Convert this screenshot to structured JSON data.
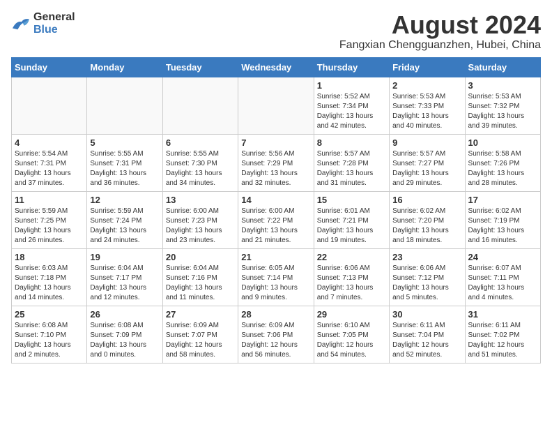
{
  "logo": {
    "line1": "General",
    "line2": "Blue"
  },
  "title": {
    "month_year": "August 2024",
    "location": "Fangxian Chengguanzhen, Hubei, China"
  },
  "weekdays": [
    "Sunday",
    "Monday",
    "Tuesday",
    "Wednesday",
    "Thursday",
    "Friday",
    "Saturday"
  ],
  "weeks": [
    [
      {
        "day": "",
        "info": ""
      },
      {
        "day": "",
        "info": ""
      },
      {
        "day": "",
        "info": ""
      },
      {
        "day": "",
        "info": ""
      },
      {
        "day": "1",
        "info": "Sunrise: 5:52 AM\nSunset: 7:34 PM\nDaylight: 13 hours\nand 42 minutes."
      },
      {
        "day": "2",
        "info": "Sunrise: 5:53 AM\nSunset: 7:33 PM\nDaylight: 13 hours\nand 40 minutes."
      },
      {
        "day": "3",
        "info": "Sunrise: 5:53 AM\nSunset: 7:32 PM\nDaylight: 13 hours\nand 39 minutes."
      }
    ],
    [
      {
        "day": "4",
        "info": "Sunrise: 5:54 AM\nSunset: 7:31 PM\nDaylight: 13 hours\nand 37 minutes."
      },
      {
        "day": "5",
        "info": "Sunrise: 5:55 AM\nSunset: 7:31 PM\nDaylight: 13 hours\nand 36 minutes."
      },
      {
        "day": "6",
        "info": "Sunrise: 5:55 AM\nSunset: 7:30 PM\nDaylight: 13 hours\nand 34 minutes."
      },
      {
        "day": "7",
        "info": "Sunrise: 5:56 AM\nSunset: 7:29 PM\nDaylight: 13 hours\nand 32 minutes."
      },
      {
        "day": "8",
        "info": "Sunrise: 5:57 AM\nSunset: 7:28 PM\nDaylight: 13 hours\nand 31 minutes."
      },
      {
        "day": "9",
        "info": "Sunrise: 5:57 AM\nSunset: 7:27 PM\nDaylight: 13 hours\nand 29 minutes."
      },
      {
        "day": "10",
        "info": "Sunrise: 5:58 AM\nSunset: 7:26 PM\nDaylight: 13 hours\nand 28 minutes."
      }
    ],
    [
      {
        "day": "11",
        "info": "Sunrise: 5:59 AM\nSunset: 7:25 PM\nDaylight: 13 hours\nand 26 minutes."
      },
      {
        "day": "12",
        "info": "Sunrise: 5:59 AM\nSunset: 7:24 PM\nDaylight: 13 hours\nand 24 minutes."
      },
      {
        "day": "13",
        "info": "Sunrise: 6:00 AM\nSunset: 7:23 PM\nDaylight: 13 hours\nand 23 minutes."
      },
      {
        "day": "14",
        "info": "Sunrise: 6:00 AM\nSunset: 7:22 PM\nDaylight: 13 hours\nand 21 minutes."
      },
      {
        "day": "15",
        "info": "Sunrise: 6:01 AM\nSunset: 7:21 PM\nDaylight: 13 hours\nand 19 minutes."
      },
      {
        "day": "16",
        "info": "Sunrise: 6:02 AM\nSunset: 7:20 PM\nDaylight: 13 hours\nand 18 minutes."
      },
      {
        "day": "17",
        "info": "Sunrise: 6:02 AM\nSunset: 7:19 PM\nDaylight: 13 hours\nand 16 minutes."
      }
    ],
    [
      {
        "day": "18",
        "info": "Sunrise: 6:03 AM\nSunset: 7:18 PM\nDaylight: 13 hours\nand 14 minutes."
      },
      {
        "day": "19",
        "info": "Sunrise: 6:04 AM\nSunset: 7:17 PM\nDaylight: 13 hours\nand 12 minutes."
      },
      {
        "day": "20",
        "info": "Sunrise: 6:04 AM\nSunset: 7:16 PM\nDaylight: 13 hours\nand 11 minutes."
      },
      {
        "day": "21",
        "info": "Sunrise: 6:05 AM\nSunset: 7:14 PM\nDaylight: 13 hours\nand 9 minutes."
      },
      {
        "day": "22",
        "info": "Sunrise: 6:06 AM\nSunset: 7:13 PM\nDaylight: 13 hours\nand 7 minutes."
      },
      {
        "day": "23",
        "info": "Sunrise: 6:06 AM\nSunset: 7:12 PM\nDaylight: 13 hours\nand 5 minutes."
      },
      {
        "day": "24",
        "info": "Sunrise: 6:07 AM\nSunset: 7:11 PM\nDaylight: 13 hours\nand 4 minutes."
      }
    ],
    [
      {
        "day": "25",
        "info": "Sunrise: 6:08 AM\nSunset: 7:10 PM\nDaylight: 13 hours\nand 2 minutes."
      },
      {
        "day": "26",
        "info": "Sunrise: 6:08 AM\nSunset: 7:09 PM\nDaylight: 13 hours\nand 0 minutes."
      },
      {
        "day": "27",
        "info": "Sunrise: 6:09 AM\nSunset: 7:07 PM\nDaylight: 12 hours\nand 58 minutes."
      },
      {
        "day": "28",
        "info": "Sunrise: 6:09 AM\nSunset: 7:06 PM\nDaylight: 12 hours\nand 56 minutes."
      },
      {
        "day": "29",
        "info": "Sunrise: 6:10 AM\nSunset: 7:05 PM\nDaylight: 12 hours\nand 54 minutes."
      },
      {
        "day": "30",
        "info": "Sunrise: 6:11 AM\nSunset: 7:04 PM\nDaylight: 12 hours\nand 52 minutes."
      },
      {
        "day": "31",
        "info": "Sunrise: 6:11 AM\nSunset: 7:02 PM\nDaylight: 12 hours\nand 51 minutes."
      }
    ]
  ]
}
